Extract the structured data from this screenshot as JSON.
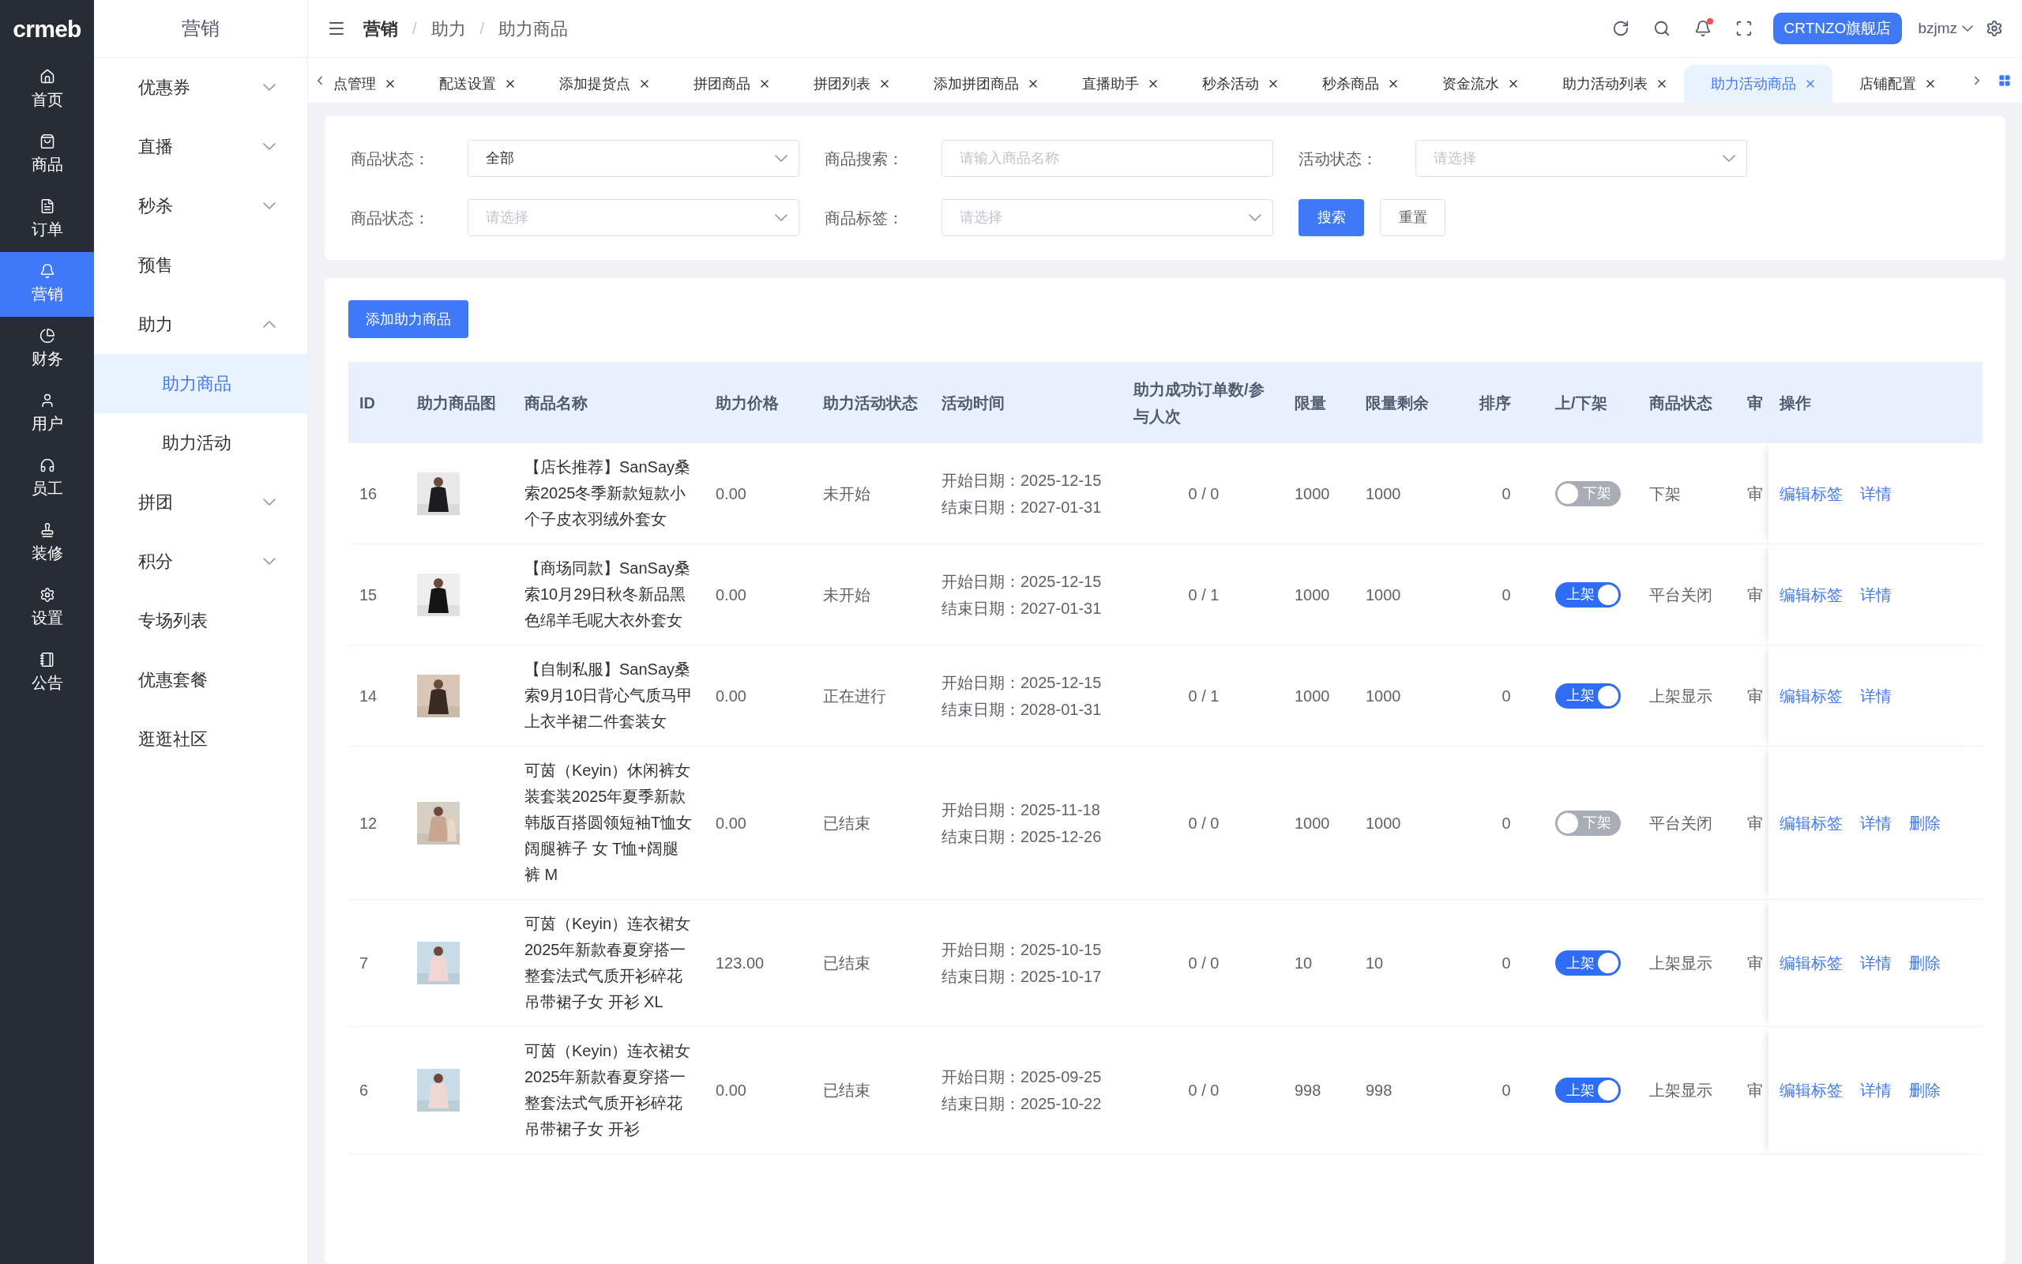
{
  "logo": "crmeb",
  "rail": [
    {
      "label": "首页",
      "selected": false
    },
    {
      "label": "商品",
      "selected": false
    },
    {
      "label": "订单",
      "selected": false
    },
    {
      "label": "营销",
      "selected": true
    },
    {
      "label": "财务",
      "selected": false
    },
    {
      "label": "用户",
      "selected": false
    },
    {
      "label": "员工",
      "selected": false
    },
    {
      "label": "装修",
      "selected": false
    },
    {
      "label": "设置",
      "selected": false
    },
    {
      "label": "公告",
      "selected": false
    }
  ],
  "submenu": {
    "title": "营销",
    "items": [
      {
        "label": "优惠券",
        "kind": "group",
        "expanded": false,
        "selected": false
      },
      {
        "label": "直播",
        "kind": "group",
        "expanded": false,
        "selected": false
      },
      {
        "label": "秒杀",
        "kind": "group",
        "expanded": false,
        "selected": false
      },
      {
        "label": "预售",
        "kind": "link",
        "selected": false
      },
      {
        "label": "助力",
        "kind": "group",
        "expanded": true,
        "selected": false,
        "children": [
          {
            "label": "助力商品",
            "selected": true
          },
          {
            "label": "助力活动",
            "selected": false
          }
        ]
      },
      {
        "label": "拼团",
        "kind": "group",
        "expanded": false,
        "selected": false
      },
      {
        "label": "积分",
        "kind": "group",
        "expanded": false,
        "selected": false
      },
      {
        "label": "专场列表",
        "kind": "link",
        "selected": false
      },
      {
        "label": "优惠套餐",
        "kind": "link",
        "selected": false
      },
      {
        "label": "逛逛社区",
        "kind": "link",
        "selected": false
      }
    ]
  },
  "header": {
    "breadcrumb": [
      "营销",
      "助力",
      "助力商品"
    ],
    "separator": "/",
    "notification_dot": true,
    "store_button": "CRTNZO旗舰店",
    "user": "bzjmz"
  },
  "tabs": [
    {
      "label": "点管理",
      "selected": false
    },
    {
      "label": "配送设置",
      "selected": false
    },
    {
      "label": "添加提货点",
      "selected": false
    },
    {
      "label": "拼团商品",
      "selected": false
    },
    {
      "label": "拼团列表",
      "selected": false
    },
    {
      "label": "添加拼团商品",
      "selected": false
    },
    {
      "label": "直播助手",
      "selected": false
    },
    {
      "label": "秒杀活动",
      "selected": false
    },
    {
      "label": "秒杀商品",
      "selected": false
    },
    {
      "label": "资金流水",
      "selected": false
    },
    {
      "label": "助力活动列表",
      "selected": false
    },
    {
      "label": "助力活动商品",
      "selected": true
    },
    {
      "label": "店铺配置",
      "selected": false
    }
  ],
  "filters": [
    {
      "kind": "select",
      "label": "商品状态：",
      "value": "全部"
    },
    {
      "kind": "input",
      "label": "商品搜索：",
      "placeholder": "请输入商品名称"
    },
    {
      "kind": "select",
      "label": "活动状态：",
      "placeholder": "请选择"
    },
    {
      "kind": "select",
      "label": "商品状态：",
      "placeholder": "请选择"
    },
    {
      "kind": "select",
      "label": "商品标签：",
      "placeholder": "请选择"
    }
  ],
  "search_button": "搜索",
  "reset_button": "重置",
  "add_button": "添加助力商品",
  "table": {
    "columns": [
      "ID",
      "助力商品图",
      "商品名称",
      "助力价格",
      "助力活动状态",
      "活动时间",
      "助力成功订单数/参与人次",
      "限量",
      "限量剩余",
      "排序",
      "上/下架",
      "商品状态",
      "审",
      "操作"
    ],
    "rows": [
      {
        "id": "16",
        "name": "【店长推荐】SanSay桑索2025冬季新款短款小个子皮衣羽绒外套女",
        "price": "0.00",
        "activity_status": "未开始",
        "start": "开始日期：2025-12-15",
        "end": "结束日期：2027-01-31",
        "success": "0 / 0",
        "limit": "1000",
        "remaining": "1000",
        "sort": "0",
        "listed": {
          "on": false,
          "label": "下架"
        },
        "product_status": "下架",
        "audit": "审",
        "actions": [
          "编辑标签",
          "详情"
        ]
      },
      {
        "id": "15",
        "name": "【商场同款】SanSay桑索10月29日秋冬新品黑色绵羊毛呢大衣外套女",
        "price": "0.00",
        "activity_status": "未开始",
        "start": "开始日期：2025-12-15",
        "end": "结束日期：2027-01-31",
        "success": "0 / 1",
        "limit": "1000",
        "remaining": "1000",
        "sort": "0",
        "listed": {
          "on": true,
          "label": "上架"
        },
        "product_status": "平台关闭",
        "audit": "审",
        "actions": [
          "编辑标签",
          "详情"
        ]
      },
      {
        "id": "14",
        "name": "【自制私服】SanSay桑索9月10日背心气质马甲上衣半裙二件套装女",
        "price": "0.00",
        "activity_status": "正在进行",
        "start": "开始日期：2025-12-15",
        "end": "结束日期：2028-01-31",
        "success": "0 / 1",
        "limit": "1000",
        "remaining": "1000",
        "sort": "0",
        "listed": {
          "on": true,
          "label": "上架"
        },
        "product_status": "上架显示",
        "audit": "审",
        "actions": [
          "编辑标签",
          "详情"
        ]
      },
      {
        "id": "12",
        "name": "可茵（Keyin）休闲裤女装套装2025年夏季新款韩版百搭圆领短袖T恤女阔腿裤子 女 T恤+阔腿裤 M",
        "price": "0.00",
        "activity_status": "已结束",
        "start": "开始日期：2025-11-18",
        "end": "结束日期：2025-12-26",
        "success": "0 / 0",
        "limit": "1000",
        "remaining": "1000",
        "sort": "0",
        "listed": {
          "on": false,
          "label": "下架"
        },
        "product_status": "平台关闭",
        "audit": "审",
        "actions": [
          "编辑标签",
          "详情",
          "删除"
        ]
      },
      {
        "id": "7",
        "name": "可茵（Keyin）连衣裙女2025年新款春夏穿搭一整套法式气质开衫碎花吊带裙子女 开衫 XL",
        "price": "123.00",
        "activity_status": "已结束",
        "start": "开始日期：2025-10-15",
        "end": "结束日期：2025-10-17",
        "success": "0 / 0",
        "limit": "10",
        "remaining": "10",
        "sort": "0",
        "listed": {
          "on": true,
          "label": "上架"
        },
        "product_status": "上架显示",
        "audit": "审",
        "actions": [
          "编辑标签",
          "详情",
          "删除"
        ]
      },
      {
        "id": "6",
        "name": "可茵（Keyin）连衣裙女2025年新款春夏穿搭一整套法式气质开衫碎花吊带裙子女 开衫",
        "price": "0.00",
        "activity_status": "已结束",
        "start": "开始日期：2025-09-25",
        "end": "结束日期：2025-10-22",
        "success": "0 / 0",
        "limit": "998",
        "remaining": "998",
        "sort": "0",
        "listed": {
          "on": true,
          "label": "上架"
        },
        "product_status": "上架显示",
        "audit": "审",
        "actions": [
          "编辑标签",
          "详情",
          "删除"
        ]
      }
    ]
  }
}
